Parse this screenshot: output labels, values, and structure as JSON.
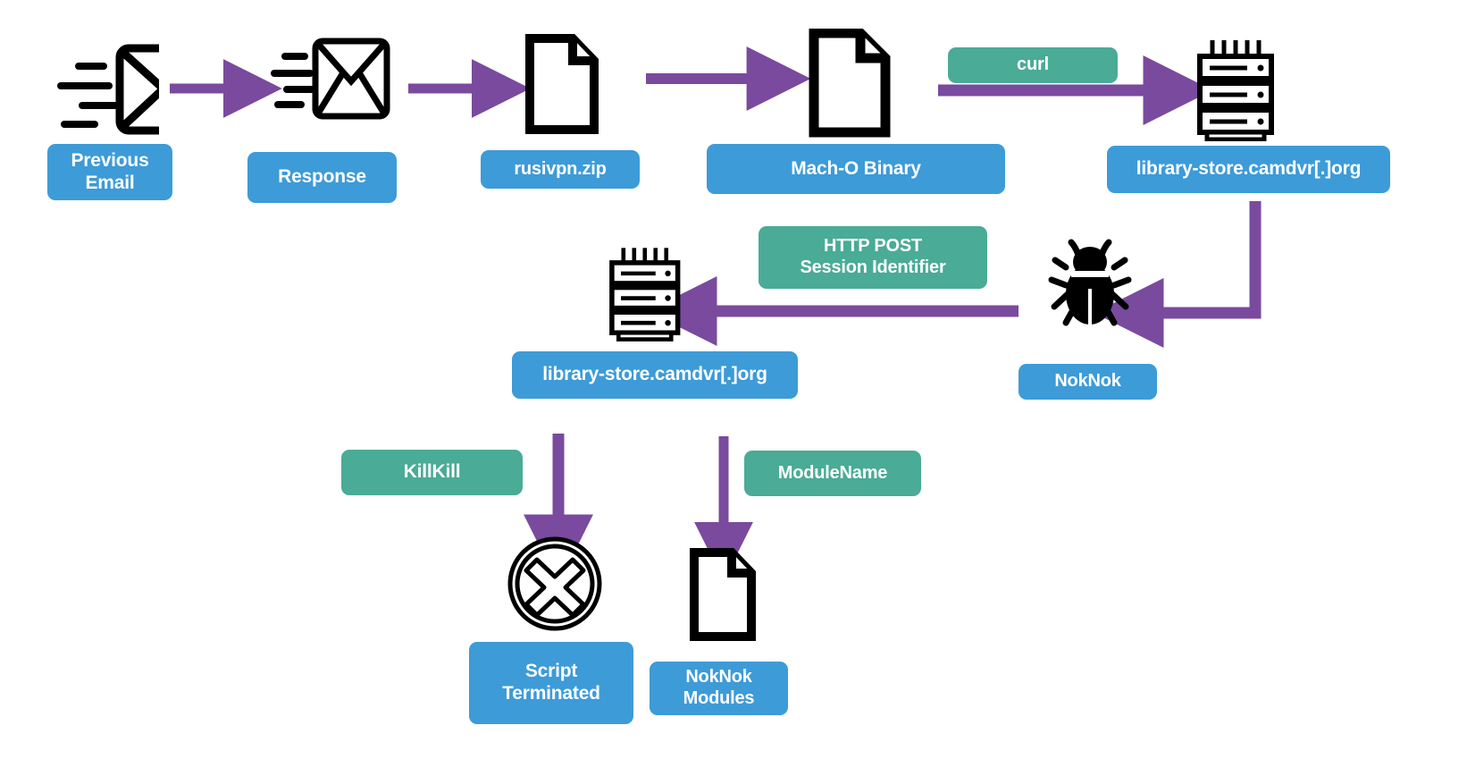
{
  "diagram": {
    "title": "NokNok macOS infection chain",
    "colors": {
      "node_blue": "#3d9bd8",
      "action_green": "#4aab96",
      "arrow_purple": "#7a4a9e",
      "icon_black": "#000000",
      "background": "#ffffff"
    }
  },
  "nodes": [
    {
      "id": "previous-email",
      "label": "Previous\nEmail",
      "icon": "email-icon",
      "style": "blue"
    },
    {
      "id": "response",
      "label": "Response",
      "icon": "email-icon",
      "style": "blue"
    },
    {
      "id": "rusivpn-zip",
      "label": "rusivpn.zip",
      "icon": "document-icon",
      "style": "blue"
    },
    {
      "id": "macho-binary",
      "label": "Mach-O Binary",
      "icon": "document-icon",
      "style": "blue"
    },
    {
      "id": "c2-server-top",
      "label": "library-store.camdvr[.]org",
      "icon": "server-icon",
      "style": "blue"
    },
    {
      "id": "noknok",
      "label": "NokNok",
      "icon": "bug-icon",
      "style": "blue"
    },
    {
      "id": "c2-server-mid",
      "label": "library-store.camdvr[.]org",
      "icon": "server-icon",
      "style": "blue"
    },
    {
      "id": "script-terminated",
      "label": "Script\nTerminated",
      "icon": "x-circle-icon",
      "style": "blue"
    },
    {
      "id": "noknok-modules",
      "label": "NokNok\nModules",
      "icon": "document-icon",
      "style": "blue"
    }
  ],
  "action_labels": [
    {
      "id": "curl",
      "label": "curl"
    },
    {
      "id": "http-post",
      "label": "HTTP POST\nSession Identifier"
    },
    {
      "id": "killkill",
      "label": "KillKill"
    },
    {
      "id": "modulename",
      "label": "ModuleName"
    }
  ]
}
